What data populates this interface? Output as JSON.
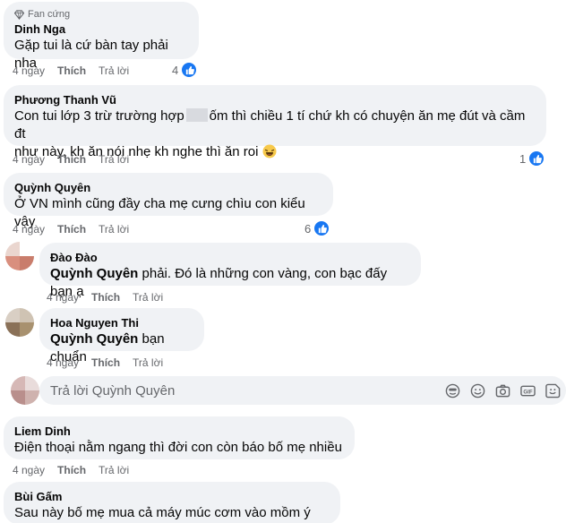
{
  "comments": [
    {
      "badge": "Fan cứng",
      "author": "Dinh Nga",
      "text": "Gặp tui là cứ bàn tay phải nha",
      "time": "4 ngày",
      "like": "Thích",
      "reply": "Trả lời",
      "reactions": "4"
    },
    {
      "author": "Phương Thanh Vũ",
      "text_a": "Con tui lớp 3 trừ trường hợp",
      "text_b": "ốm thì chiều 1 tí chứ kh có chuyện ăn mẹ đút và cầm đt",
      "text_c": "như này, kh ăn nói nhẹ kh nghe thì ăn roi",
      "time": "4 ngày",
      "like": "Thích",
      "reply": "Trả lời",
      "reactions": "1"
    },
    {
      "author": "Quỳnh Quyên",
      "text": "Ở VN mình cũng đầy cha mẹ cưng chìu con kiểu vậy",
      "time": "4 ngày",
      "like": "Thích",
      "reply": "Trả lời",
      "reactions": "6"
    },
    {
      "author": "Đào Đào",
      "mention": "Quỳnh Quyên",
      "text": " phải. Đó là những con vàng, con bạc đấy bạn ạ",
      "time": "4 ngày",
      "like": "Thích",
      "reply": "Trả lời"
    },
    {
      "author": "Hoa Nguyen Thi",
      "mention": "Quỳnh Quyên",
      "text": " bạn chuẩn",
      "time": "4 ngày",
      "like": "Thích",
      "reply": "Trả lời"
    },
    {
      "author": "Liem Dinh",
      "text": "Điện thoại nằm ngang thì đời con còn báo bố mẹ nhiều",
      "time": "4 ngày",
      "like": "Thích",
      "reply": "Trả lời"
    },
    {
      "author": "Bùi Gấm",
      "text": "Sau này bố mẹ mua cả máy múc cơm vào mồm ý chứ"
    }
  ],
  "reply_box": {
    "placeholder": "Trả lời Quỳnh Quyên",
    "tools": [
      "avatar-sticker-icon",
      "emoji-icon",
      "camera-icon",
      "gif-icon",
      "sticker-icon"
    ]
  },
  "colors": {
    "bubble": "#f0f2f5",
    "accent": "#1877f2",
    "secondary_text": "#65676b"
  }
}
